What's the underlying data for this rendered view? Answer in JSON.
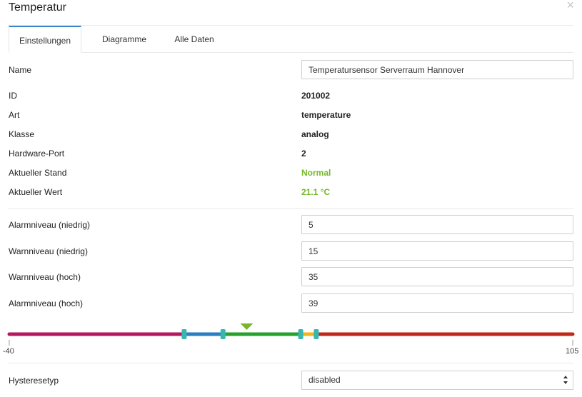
{
  "header": {
    "title": "Temperatur",
    "close_icon": "close-icon",
    "close_glyph": "×"
  },
  "tabs": [
    {
      "label": "Einstellungen",
      "active": true
    },
    {
      "label": "Diagramme",
      "active": false
    },
    {
      "label": "Alle Daten",
      "active": false
    }
  ],
  "name": {
    "label": "Name",
    "value": "Temperatursensor Serverraum Hannover"
  },
  "info": [
    {
      "label": "ID",
      "value": "201002",
      "highlight": false
    },
    {
      "label": "Art",
      "value": "temperature",
      "highlight": false
    },
    {
      "label": "Klasse",
      "value": "analog",
      "highlight": false
    },
    {
      "label": "Hardware-Port",
      "value": "2",
      "highlight": false
    },
    {
      "label": "Aktueller Stand",
      "value": "Normal",
      "highlight": true
    },
    {
      "label": "Aktueller Wert",
      "value": "21.1 °C",
      "highlight": true
    }
  ],
  "thresholds": [
    {
      "label": "Alarmniveau (niedrig)",
      "value": "5"
    },
    {
      "label": "Warnniveau (niedrig)",
      "value": "15"
    },
    {
      "label": "Warnniveau (hoch)",
      "value": "35"
    },
    {
      "label": "Alarmniveau (hoch)",
      "value": "39"
    }
  ],
  "scale": {
    "min": -40,
    "max": 105,
    "min_label": "-40",
    "max_label": "105",
    "current": 21.1,
    "alarm_low": 5,
    "warn_low": 15,
    "warn_high": 35,
    "alarm_high": 39,
    "colors": {
      "alarm_low": "#b5185f",
      "warn_low": "#2a7fc0",
      "normal": "#27a02e",
      "warn_high": "#f3b41a",
      "alarm_high": "#c0281a",
      "handle": "#38b6b0",
      "marker": "#76b82a"
    }
  },
  "hysteresis": {
    "label": "Hysteresetyp",
    "value": "disabled"
  },
  "accent": "#3a86c8",
  "status_green": "#76b82a"
}
